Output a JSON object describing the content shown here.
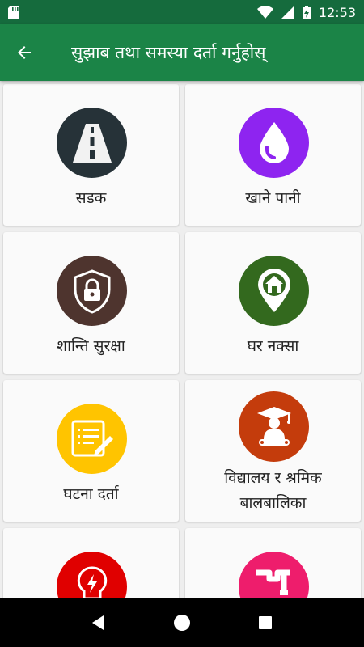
{
  "status_bar": {
    "time": "12:53",
    "icons": [
      "sd-card-icon",
      "wifi-icon",
      "cellular-signal-icon",
      "battery-charging-icon"
    ]
  },
  "app_bar": {
    "title": "सुझाब तथा समस्या दर्ता गर्नुहोस्",
    "back_icon": "arrow-back-icon",
    "color": "#1b8447"
  },
  "categories": [
    {
      "label": "सडक",
      "icon": "road-icon",
      "color": "#263238"
    },
    {
      "label": "खाने पानी",
      "icon": "water-drop-icon",
      "color": "#8e24f0"
    },
    {
      "label": "शान्ति सुरक्षा",
      "icon": "shield-lock-icon",
      "color": "#4e342e"
    },
    {
      "label": "घर नक्सा",
      "icon": "home-location-icon",
      "color": "#33691e"
    },
    {
      "label": "घटना दर्ता",
      "icon": "form-edit-icon",
      "color": "#ffc400"
    },
    {
      "label_line1": "विद्यालय र श्रमिक",
      "label_line2": "बालबालिका",
      "icon": "graduate-icon",
      "color": "#c43c0c"
    },
    {
      "label": "",
      "icon": "lightbulb-bolt-icon",
      "color": "#e00000"
    },
    {
      "label": "",
      "icon": "pipe-icon",
      "color": "#ee1d6c"
    }
  ],
  "nav_bar": {
    "buttons": [
      "back-triangle-icon",
      "home-circle-icon",
      "recents-square-icon"
    ]
  }
}
